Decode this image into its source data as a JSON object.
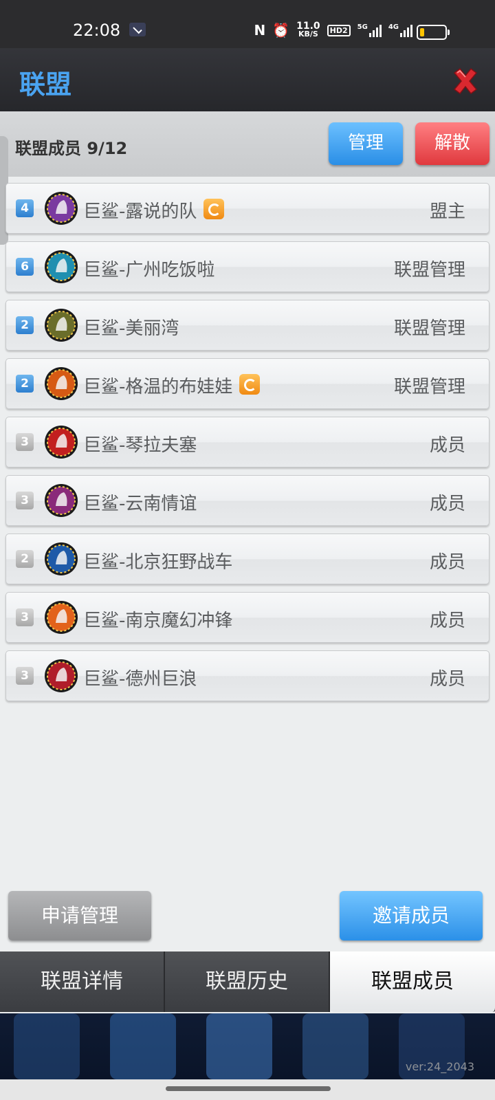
{
  "status_bar": {
    "time": "22:08",
    "speed_value": "11.0",
    "speed_unit": "KB/S",
    "hd": "HD2",
    "net1": "5G",
    "net2": "4G"
  },
  "header": {
    "title": "联盟",
    "close_icon": "close-x-icon"
  },
  "members": {
    "count_label": "联盟成员 9/12",
    "manage_label": "管理",
    "disband_label": "解散",
    "rows": [
      {
        "level": "4",
        "level_color": "blue",
        "name": "巨鲨-露说的队",
        "role": "盟主",
        "sync": true,
        "avatar_color": "#7a3aa0"
      },
      {
        "level": "6",
        "level_color": "blue",
        "name": "巨鲨-广州吃饭啦",
        "role": "联盟管理",
        "sync": false,
        "avatar_color": "#1f8fb0"
      },
      {
        "level": "2",
        "level_color": "blue",
        "name": "巨鲨-美丽湾",
        "role": "联盟管理",
        "sync": false,
        "avatar_color": "#6a6d2a"
      },
      {
        "level": "2",
        "level_color": "blue",
        "name": "巨鲨-格温的布娃娃",
        "role": "联盟管理",
        "sync": true,
        "avatar_color": "#d65a14"
      },
      {
        "level": "3",
        "level_color": "gray",
        "name": "巨鲨-琴拉夫塞",
        "role": "成员",
        "sync": false,
        "avatar_color": "#c21f1f"
      },
      {
        "level": "3",
        "level_color": "gray",
        "name": "巨鲨-云南情谊",
        "role": "成员",
        "sync": false,
        "avatar_color": "#8a2a7a"
      },
      {
        "level": "2",
        "level_color": "gray",
        "name": "巨鲨-北京狂野战车",
        "role": "成员",
        "sync": false,
        "avatar_color": "#1e5aa8"
      },
      {
        "level": "3",
        "level_color": "gray",
        "name": "巨鲨-南京魔幻冲锋",
        "role": "成员",
        "sync": false,
        "avatar_color": "#e2621b"
      },
      {
        "level": "3",
        "level_color": "gray",
        "name": "巨鲨-德州巨浪",
        "role": "成员",
        "sync": false,
        "avatar_color": "#b01d2a"
      }
    ]
  },
  "actions": {
    "apply_label": "申请管理",
    "invite_label": "邀请成员"
  },
  "tabs": [
    {
      "label": "联盟详情",
      "active": false
    },
    {
      "label": "联盟历史",
      "active": false
    },
    {
      "label": "联盟成员",
      "active": true
    }
  ],
  "footer": {
    "version": "ver:24_2043"
  }
}
